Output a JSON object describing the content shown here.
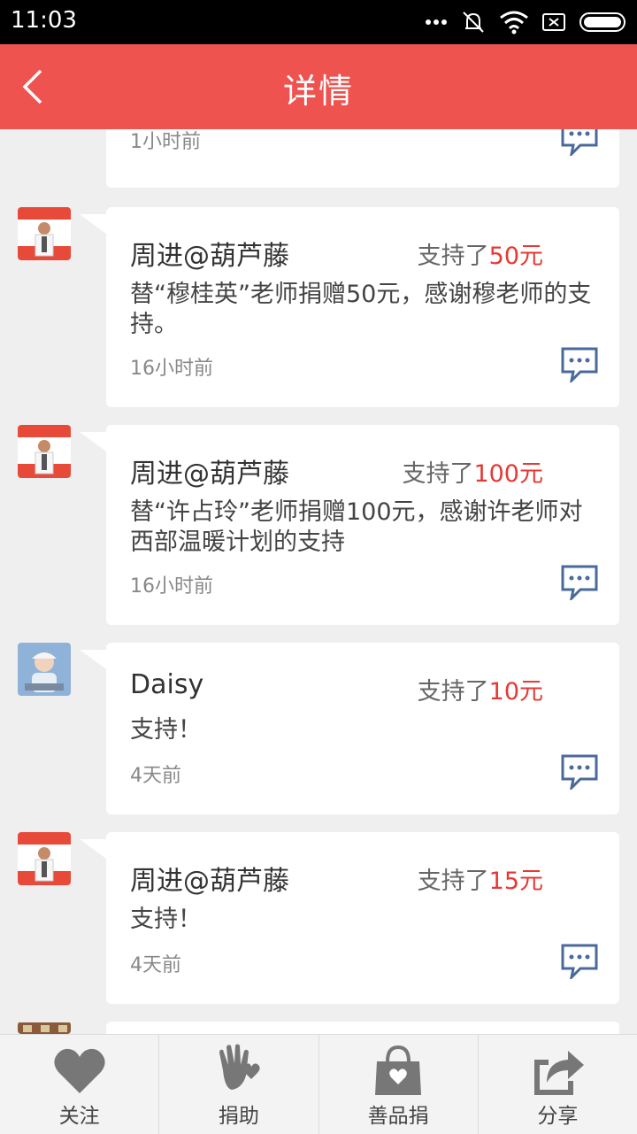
{
  "status_bar": {
    "time": "11:03"
  },
  "header": {
    "title": "详情"
  },
  "partial_card": {
    "time": "1小时前"
  },
  "posts": [
    {
      "name": "周进@葫芦藤",
      "support_prefix": "支持了",
      "amount": "50元",
      "text": "替“穆桂英”老师捐赠50元，感谢穆老师的支持。",
      "time": "16小时前"
    },
    {
      "name": "周进@葫芦藤",
      "support_prefix": "支持了",
      "amount": "100元",
      "text": "替“许占玲”老师捐赠100元，感谢许老师对西部温暖计划的支持",
      "time": "16小时前"
    },
    {
      "name": "Daisy",
      "support_prefix": "支持了",
      "amount": "10元",
      "text": "支持！",
      "time": "4天前"
    },
    {
      "name": "周进@葫芦藤",
      "support_prefix": "支持了",
      "amount": "15元",
      "text": "支持！",
      "time": "4天前"
    }
  ],
  "bottom_nav": [
    {
      "label": "关注",
      "icon": "heart-icon"
    },
    {
      "label": "捐助",
      "icon": "hand-heart-icon"
    },
    {
      "label": "善品捐",
      "icon": "bag-icon"
    },
    {
      "label": "分享",
      "icon": "share-icon"
    }
  ],
  "colors": {
    "accent": "#ef5350",
    "money": "#e53935",
    "icon": "#4a6a9c"
  }
}
